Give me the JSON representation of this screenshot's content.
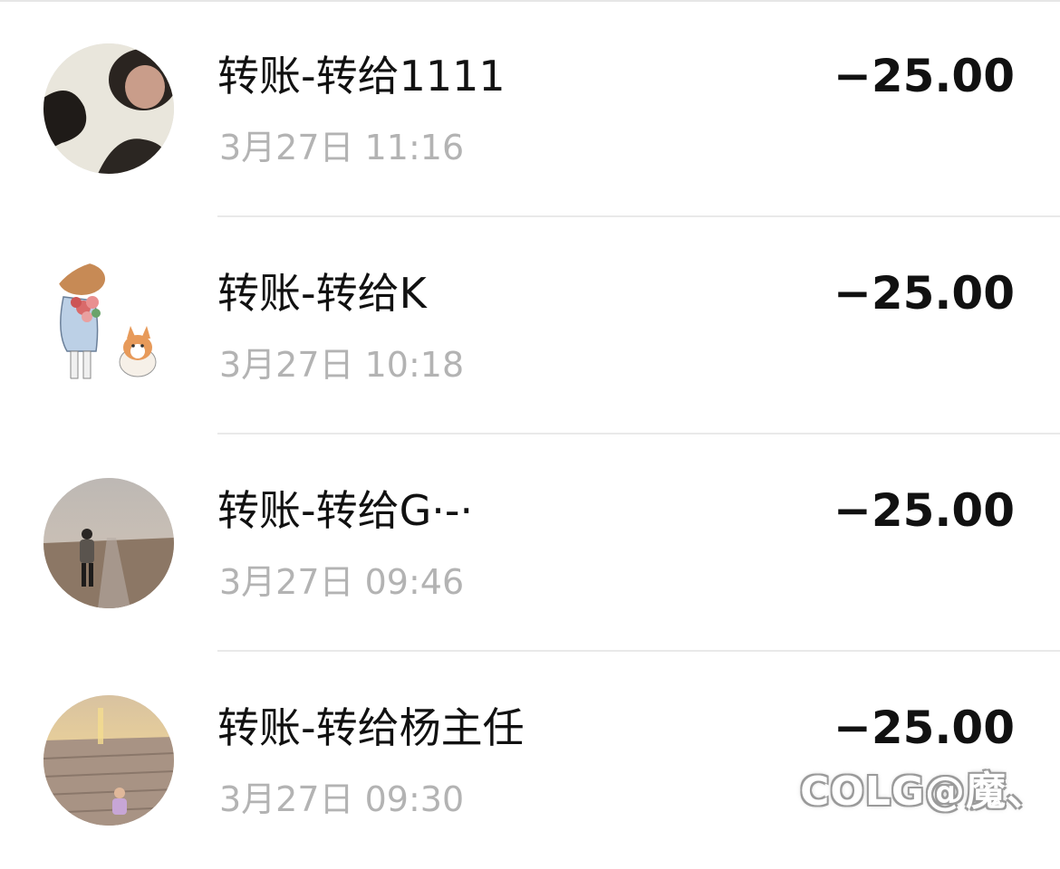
{
  "transactions": [
    {
      "title": "转账-转给1111",
      "time": "3月27日 11:16",
      "amount": "−25.00",
      "avatar": "photo-avatar-person-dark-hair"
    },
    {
      "title": "转账-转给K",
      "time": "3月27日 10:18",
      "amount": "−25.00",
      "avatar": "illustration-avatar-person-with-flowers-and-corgi"
    },
    {
      "title": "转账-转给G·-·",
      "time": "3月27日 09:46",
      "amount": "−25.00",
      "avatar": "photo-avatar-person-standing-on-beach"
    },
    {
      "title": "转账-转给杨主任",
      "time": "3月27日 09:30",
      "amount": "−25.00",
      "avatar": "photo-avatar-sunset-beach-child"
    }
  ],
  "watermark": "COLG@魔、",
  "colors": {
    "title_text": "#111111",
    "time_text": "#b3b3b3",
    "amount_text": "#111111",
    "divider": "#e9e9e9",
    "background": "#ffffff"
  }
}
